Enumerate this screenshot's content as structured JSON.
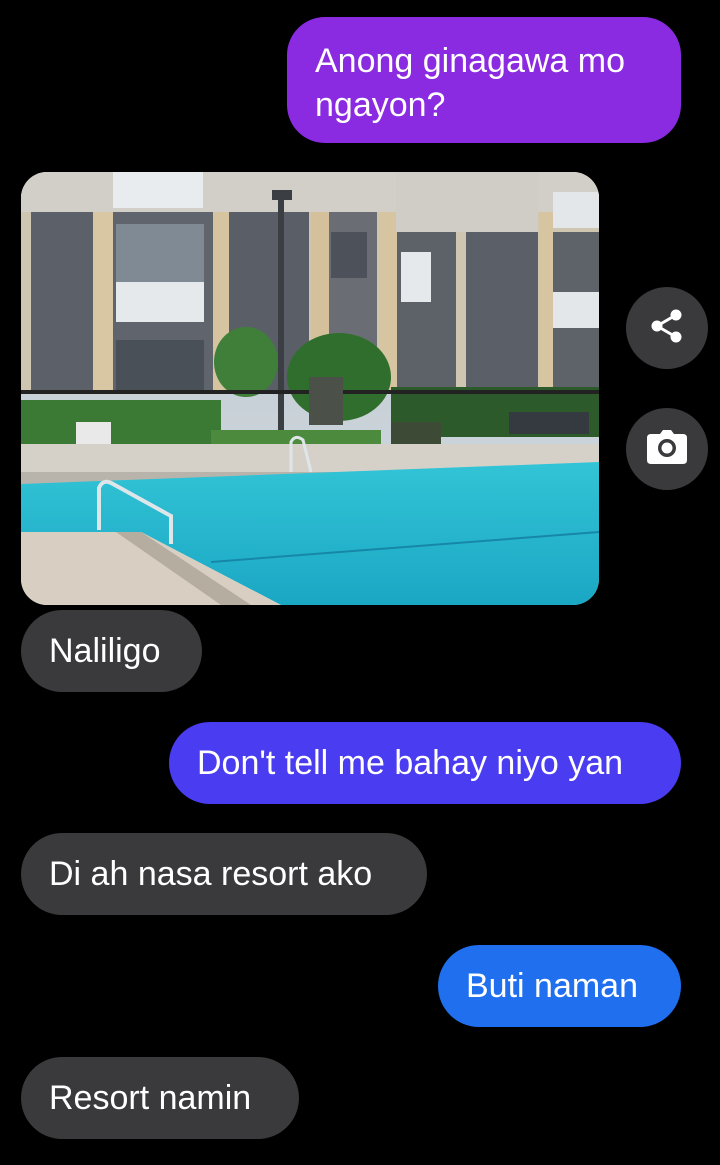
{
  "colors": {
    "background": "#000000",
    "sent_bubble_purple": "#8a2be2",
    "sent_bubble_blue_violet": "#4a3cf0",
    "sent_bubble_blue": "#1f6fef",
    "received_bubble": "#3a3a3c",
    "text": "#ffffff"
  },
  "messages": [
    {
      "direction": "outgoing",
      "text": "Anong ginagawa mo ngayon?"
    },
    {
      "direction": "incoming",
      "type": "photo",
      "description_icon": "pool-photo"
    },
    {
      "direction": "incoming",
      "text": "Naliligo"
    },
    {
      "direction": "outgoing",
      "text": "Don't tell me bahay niyo yan"
    },
    {
      "direction": "incoming",
      "text": "Di ah nasa resort ako"
    },
    {
      "direction": "outgoing",
      "text": "Buti naman"
    },
    {
      "direction": "incoming",
      "text": "Resort namin"
    }
  ],
  "actions": {
    "share_icon": "share-icon",
    "camera_icon": "camera-icon"
  }
}
